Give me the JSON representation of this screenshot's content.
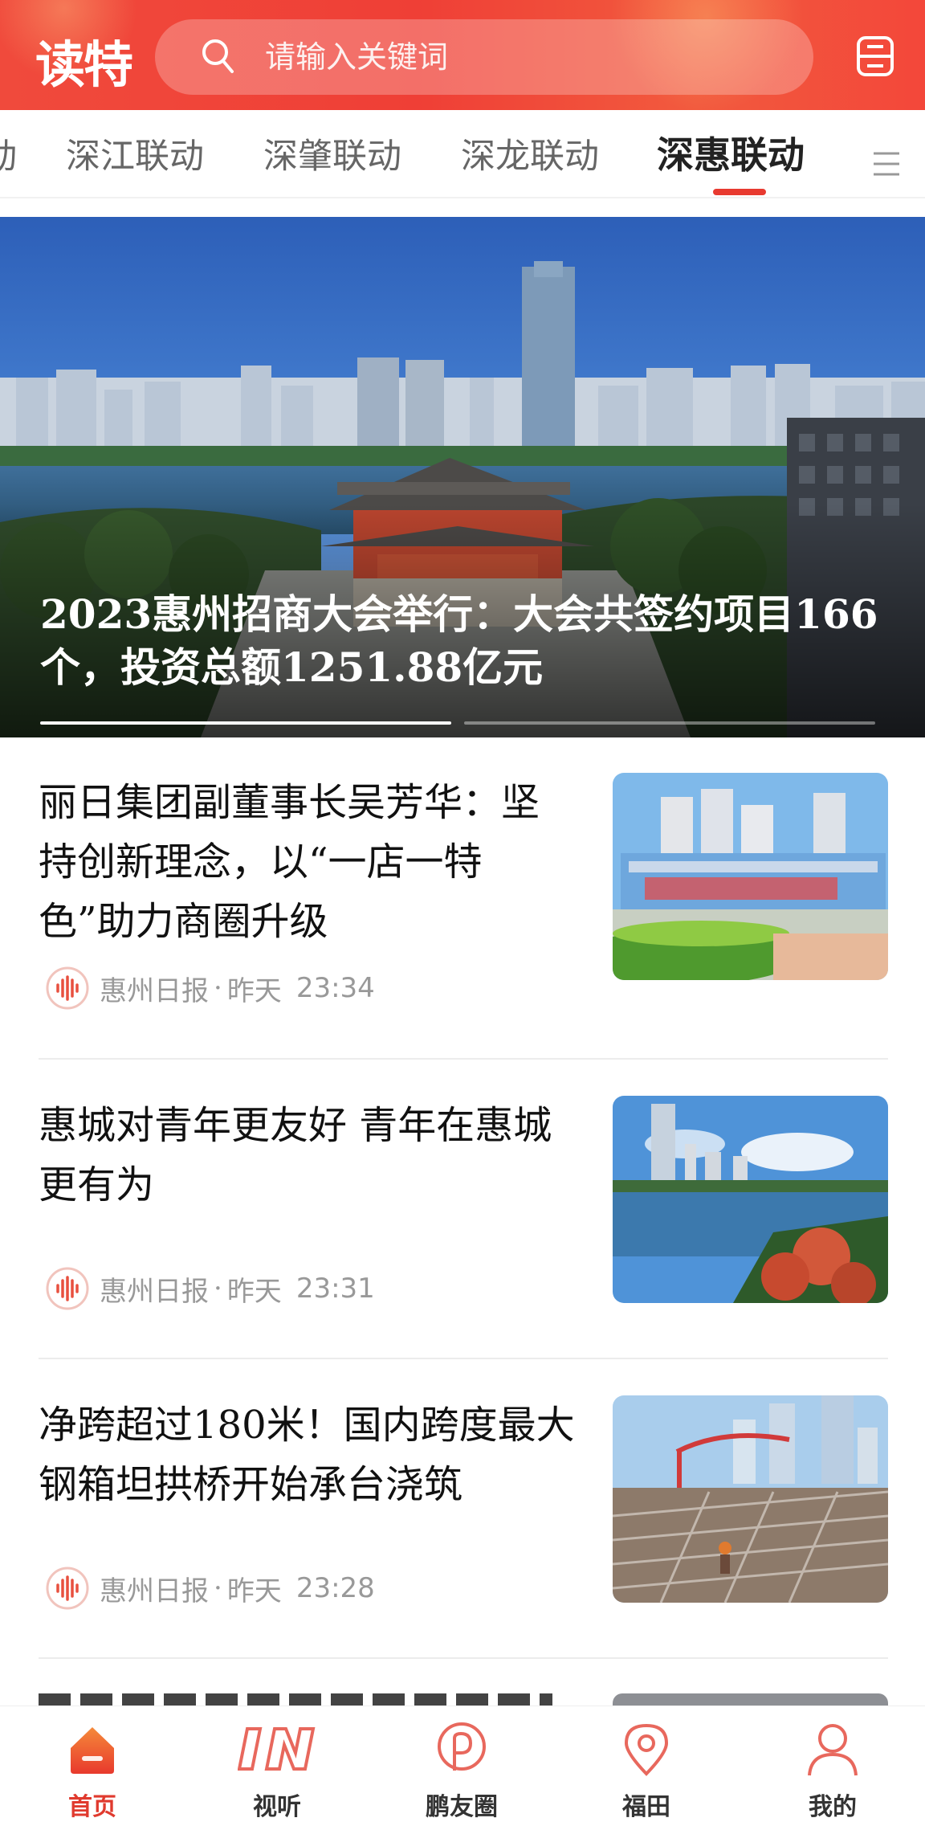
{
  "header": {
    "logo": "读特",
    "search_placeholder": "请输入关键词"
  },
  "tabs": [
    {
      "label": "动"
    },
    {
      "label": "深江联动"
    },
    {
      "label": "深肇联动"
    },
    {
      "label": "深龙联动"
    },
    {
      "label": "深惠联动",
      "active": true
    }
  ],
  "hero": {
    "title": "2023惠州招商大会举行：大会共签约项目166个，投资总额1251.88亿元"
  },
  "news": [
    {
      "title": "丽日集团副董事长吴芳华：坚持创新理念，以“一店一特色”助力商圈升级",
      "source": "惠州日报",
      "separator": "·",
      "day": "昨天",
      "time": "23:34"
    },
    {
      "title": "惠城对青年更友好  青年在惠城更有为",
      "source": "惠州日报",
      "separator": "·",
      "day": "昨天",
      "time": "23:31"
    },
    {
      "title": "净跨超过180米！国内跨度最大钢箱坦拱桥开始承台浇筑",
      "source": "惠州日报",
      "separator": "·",
      "day": "昨天",
      "time": "23:28"
    }
  ],
  "bottom_nav": [
    {
      "label": "首页",
      "icon": "home-icon",
      "active": true
    },
    {
      "label": "视听",
      "icon": "in-icon"
    },
    {
      "label": "鹏友圈",
      "icon": "p-circle-icon"
    },
    {
      "label": "福田",
      "icon": "location-pin-icon"
    },
    {
      "label": "我的",
      "icon": "user-icon"
    }
  ],
  "colors": {
    "brand_red": "#e83a30",
    "header_red": "#f04a3c",
    "meta_gray": "#999999"
  }
}
